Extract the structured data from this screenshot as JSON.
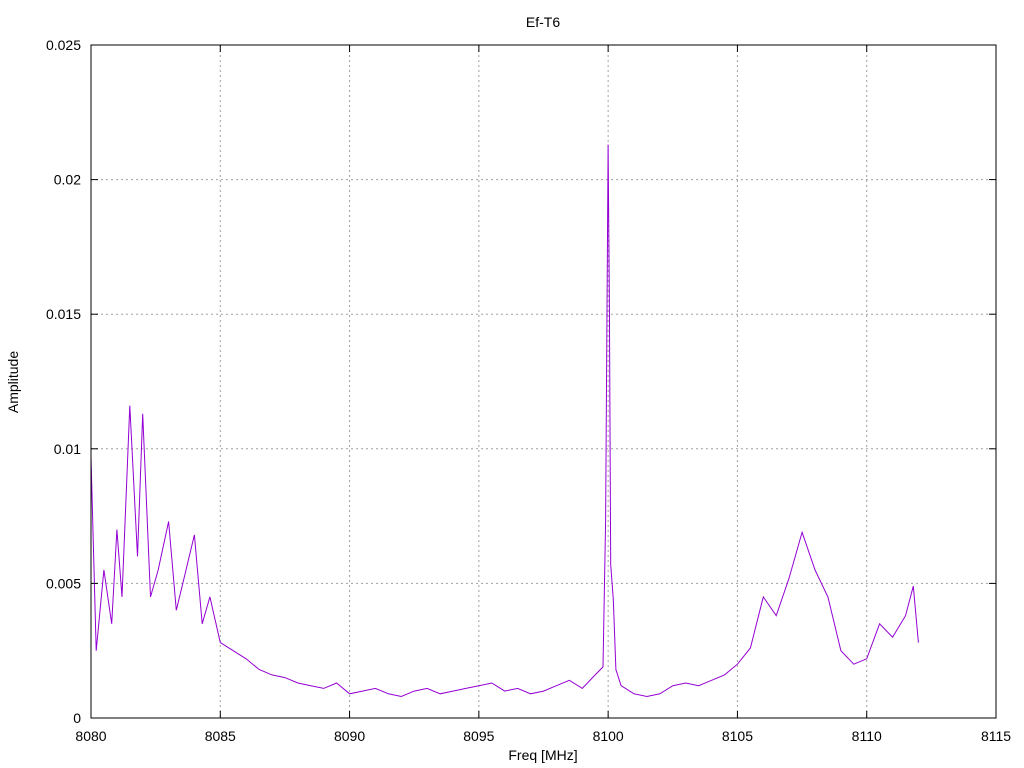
{
  "chart_data": {
    "type": "line",
    "title": "Ef-T6",
    "xlabel": "Freq [MHz]",
    "ylabel": "Amplitude",
    "xlim": [
      8080,
      8115
    ],
    "ylim": [
      0,
      0.025
    ],
    "x_ticks": [
      "8080",
      "8085",
      "8090",
      "8095",
      "8100",
      "8105",
      "8110",
      "8115"
    ],
    "y_ticks": [
      "0",
      "0.005",
      "0.01",
      "0.015",
      "0.02",
      "0.025"
    ],
    "grid": true,
    "legend": "none",
    "series": [
      {
        "color": "#9400d3",
        "x": [
          8080.0,
          8080.2,
          8080.5,
          8080.8,
          8081.0,
          8081.2,
          8081.5,
          8081.8,
          8082.0,
          8082.3,
          8082.6,
          8083.0,
          8083.3,
          8083.6,
          8084.0,
          8084.3,
          8084.6,
          8085.0,
          8085.5,
          8086.0,
          8086.5,
          8087.0,
          8087.5,
          8088.0,
          8088.5,
          8089.0,
          8089.5,
          8090.0,
          8090.5,
          8091.0,
          8091.5,
          8092.0,
          8092.5,
          8093.0,
          8093.5,
          8094.0,
          8094.5,
          8095.0,
          8095.5,
          8096.0,
          8096.5,
          8097.0,
          8097.5,
          8098.0,
          8098.5,
          8099.0,
          8099.5,
          8099.8,
          8099.9,
          8100.0,
          8100.05,
          8100.1,
          8100.2,
          8100.3,
          8100.5,
          8101.0,
          8101.5,
          8102.0,
          8102.5,
          8103.0,
          8103.5,
          8104.0,
          8104.5,
          8105.0,
          8105.5,
          8106.0,
          8106.5,
          8107.0,
          8107.5,
          8108.0,
          8108.5,
          8109.0,
          8109.5,
          8110.0,
          8110.5,
          8111.0,
          8111.5,
          8111.8,
          8112.0
        ],
        "y": [
          0.0097,
          0.0025,
          0.0055,
          0.0035,
          0.007,
          0.0045,
          0.0116,
          0.006,
          0.0113,
          0.0045,
          0.0055,
          0.0073,
          0.004,
          0.0052,
          0.0068,
          0.0035,
          0.0045,
          0.0028,
          0.0025,
          0.0022,
          0.0018,
          0.0016,
          0.0015,
          0.0013,
          0.0012,
          0.0011,
          0.0013,
          0.0009,
          0.001,
          0.0011,
          0.0009,
          0.0008,
          0.001,
          0.0011,
          0.0009,
          0.001,
          0.0011,
          0.0012,
          0.0013,
          0.001,
          0.0011,
          0.0009,
          0.001,
          0.0012,
          0.0014,
          0.0011,
          0.0016,
          0.0019,
          0.0073,
          0.0213,
          0.0153,
          0.0057,
          0.0044,
          0.0018,
          0.0012,
          0.0009,
          0.0008,
          0.0009,
          0.0012,
          0.0013,
          0.0012,
          0.0014,
          0.0016,
          0.002,
          0.0026,
          0.0045,
          0.0038,
          0.0052,
          0.0069,
          0.0055,
          0.0045,
          0.0025,
          0.002,
          0.0022,
          0.0035,
          0.003,
          0.0038,
          0.0049,
          0.0028
        ]
      }
    ]
  }
}
